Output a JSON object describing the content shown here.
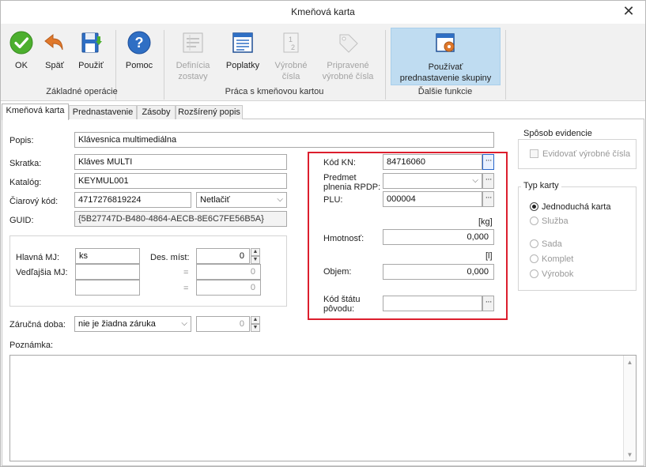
{
  "window": {
    "title": "Kmeňová karta",
    "close_glyph": "✕"
  },
  "ribbon": {
    "buttons": {
      "ok": "OK",
      "back": "Späť",
      "apply": "Použiť",
      "help": "Pomoc",
      "definition_line1": "Definícia",
      "definition_line2": "zostavy",
      "fees": "Poplatky",
      "serial_line1": "Výrobné",
      "serial_line2": "čísla",
      "prepared_line1": "Pripravené",
      "prepared_line2": "výrobné čísla",
      "group_line1": "Používať",
      "group_line2": "prednastavenie skupiny"
    },
    "groups": {
      "basic": "Základné operácie",
      "work": "Práca s kmeňovou kartou",
      "more": "Ďalšie funkcie"
    },
    "icons": {
      "ok": "ok-check-icon",
      "back": "undo-arrow-icon",
      "apply": "save-disk-icon",
      "help": "help-question-icon",
      "definition": "report-definition-icon",
      "fees": "fees-document-icon",
      "serial": "serial-numbers-icon",
      "prepared": "tag-icon",
      "group": "group-settings-icon"
    }
  },
  "tabs": [
    "Kmeňová karta",
    "Prednastavenie",
    "Zásoby",
    "Rozšírený popis"
  ],
  "form": {
    "labels": {
      "popis": "Popis:",
      "skratka": "Skratka:",
      "katalog": "Katalóg:",
      "ciarovy_kod": "Čiarový kód:",
      "guid": "GUID:",
      "hlavna_mj": "Hlavná MJ:",
      "vedlajsia_mj": "Vedľajšia MJ:",
      "des_mist": "Des. míst:",
      "eq": "=",
      "zarucna_doba": "Záručná doba:",
      "poznamka": "Poznámka:"
    },
    "values": {
      "popis": "Klávesnica multimediálna",
      "skratka": "Kláves MULTI",
      "katalog": "KEYMUL001",
      "ciarovy_kod": "4717276819224",
      "netlacit": "Netlačiť",
      "guid": "{5B27747D-B480-4864-AECB-8E6C7FE56B5A}",
      "hlavna_mj": "ks",
      "vedlajsia_mj": "",
      "des_mist": "0",
      "conv1": "0",
      "conv2": "0",
      "zarucna_doba": "nie je žiadna záruka",
      "zaruka_pocet": "0",
      "poznamka": ""
    }
  },
  "kn": {
    "labels": {
      "kod_kn": "Kód KN:",
      "predmet_line1": "Predmet",
      "predmet_line2": "plnenia RPDP:",
      "plu": "PLU:",
      "hmotnost": "Hmotnosť:",
      "objem": "Objem:",
      "kod_statu_line1": "Kód štátu",
      "kod_statu_line2": "pôvodu:",
      "unit_kg": "[kg]",
      "unit_l": "[l]"
    },
    "values": {
      "kod_kn": "84716060",
      "predmet": "",
      "plu": "000004",
      "hmotnost": "0,000",
      "objem": "0,000",
      "kod_statu": ""
    },
    "dots": "···"
  },
  "evidence": {
    "title": "Spôsob evidencie",
    "checkbox_label": "Evidovať výrobné čísla",
    "checked": false
  },
  "card_type": {
    "title": "Typ karty",
    "options": [
      "Jednoduchá karta",
      "Služba",
      "Sada",
      "Komplet",
      "Výrobok"
    ],
    "selected": "Jednoduchá karta"
  },
  "colors": {
    "highlight_border": "#dc1e2d",
    "ribbon_selected": "#bfdcf1",
    "ok_green": "#4caf2e",
    "help_blue": "#2f6fc4",
    "back_orange": "#e0782b"
  }
}
